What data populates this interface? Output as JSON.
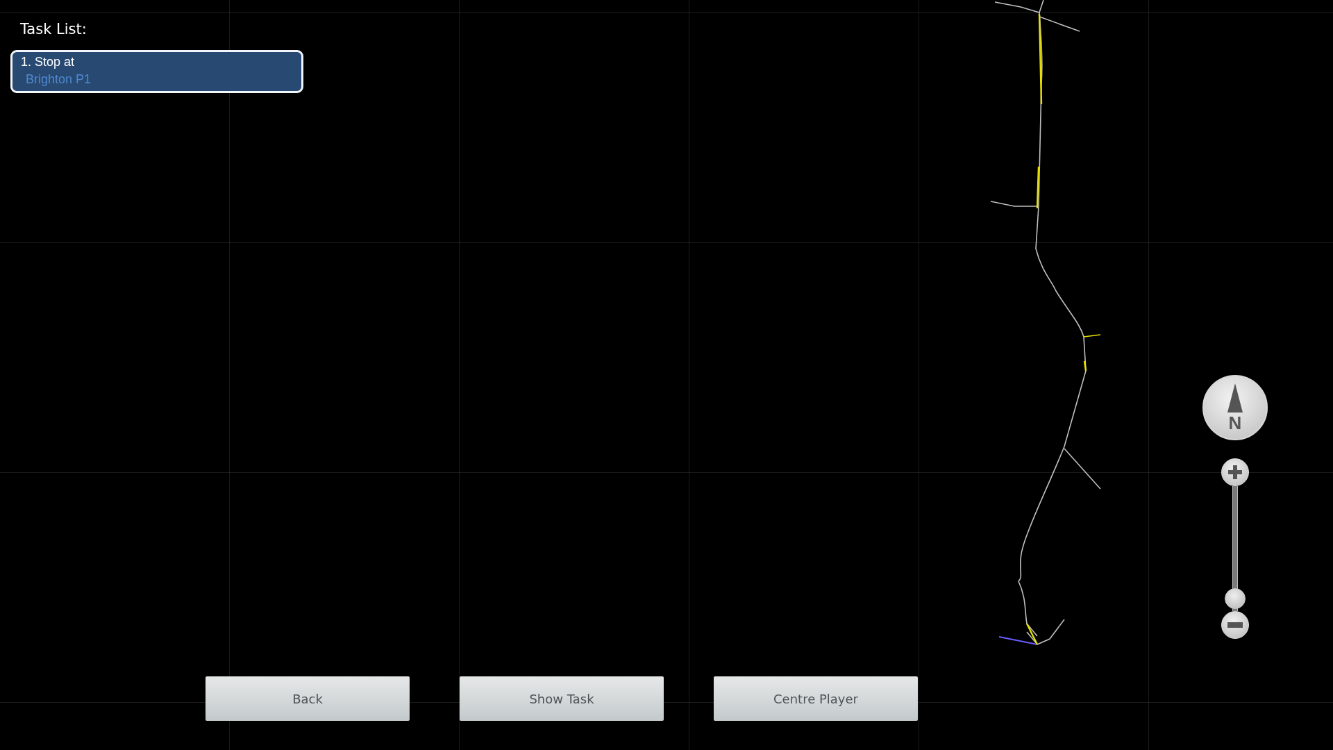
{
  "task_list": {
    "title": "Task List:",
    "tasks": [
      {
        "number_action": "1. Stop at",
        "destination": "Brighton P1",
        "selected": true
      }
    ]
  },
  "compass": {
    "label": "N"
  },
  "zoom": {
    "level": 0.02
  },
  "buttons": [
    "Back",
    "Show Task",
    "Centre Player"
  ]
}
